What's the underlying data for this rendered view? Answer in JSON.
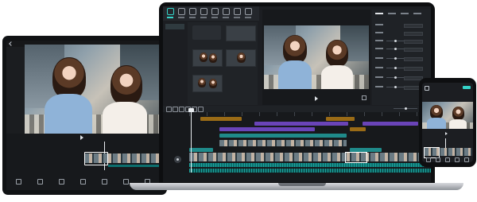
{
  "laptop": {
    "media_tabs": [
      "",
      ""
    ],
    "preview": {
      "title": "",
      "timecode": ""
    },
    "timeline": {
      "tracks": [
        {
          "label": "",
          "color": "#9a6b16"
        },
        {
          "label": "",
          "color": "#6a44b8"
        },
        {
          "label": "",
          "color": "#1f8a8a"
        },
        {
          "label": "",
          "color": "#1f8a8a"
        }
      ]
    },
    "colors": {
      "accent": "#35d3c8",
      "text_track": "#6a44b8",
      "sticker_track": "#9a6b16",
      "audio_track": "#0c6f6e"
    }
  },
  "tablet": {
    "preview_timecode": ""
  },
  "phone": {},
  "icons": {
    "undo": "undo-icon",
    "redo": "redo-icon",
    "split": "split-icon",
    "delete": "delete-icon",
    "play": "play-icon",
    "record": "record-icon",
    "fullscreen": "fullscreen-icon"
  }
}
